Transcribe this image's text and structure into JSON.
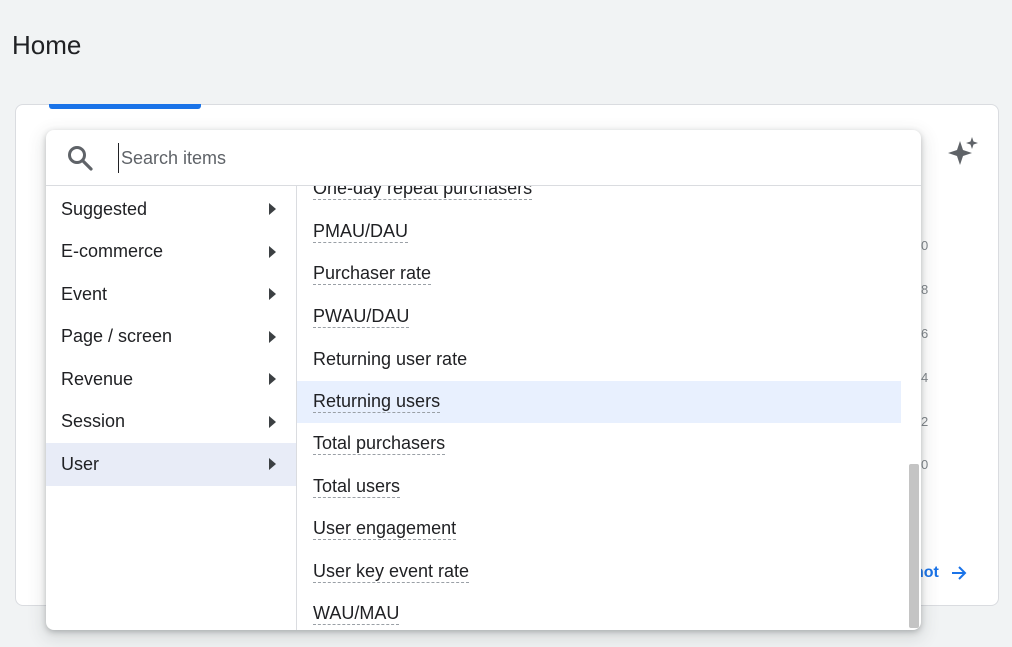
{
  "page": {
    "title": "Home"
  },
  "card": {
    "y_ticks": [
      "0",
      "8",
      "6",
      "4",
      "2",
      "0"
    ],
    "link_label": "not"
  },
  "search": {
    "placeholder": "Search items",
    "value": ""
  },
  "categories": [
    {
      "label": "Suggested",
      "active": false
    },
    {
      "label": "E-commerce",
      "active": false
    },
    {
      "label": "Event",
      "active": false
    },
    {
      "label": "Page / screen",
      "active": false
    },
    {
      "label": "Revenue",
      "active": false
    },
    {
      "label": "Session",
      "active": false
    },
    {
      "label": "User",
      "active": true
    }
  ],
  "metrics": [
    {
      "label": "One-day repeat purchasers",
      "dashed": true,
      "highlight": false
    },
    {
      "label": "PMAU/DAU",
      "dashed": true,
      "highlight": false
    },
    {
      "label": "Purchaser rate",
      "dashed": true,
      "highlight": false
    },
    {
      "label": "PWAU/DAU",
      "dashed": true,
      "highlight": false
    },
    {
      "label": "Returning user rate",
      "dashed": false,
      "highlight": false
    },
    {
      "label": "Returning users",
      "dashed": true,
      "highlight": true
    },
    {
      "label": "Total purchasers",
      "dashed": true,
      "highlight": false
    },
    {
      "label": "Total users",
      "dashed": true,
      "highlight": false
    },
    {
      "label": "User engagement",
      "dashed": true,
      "highlight": false
    },
    {
      "label": "User key event rate",
      "dashed": true,
      "highlight": false
    },
    {
      "label": "WAU/MAU",
      "dashed": true,
      "highlight": false
    }
  ],
  "colors": {
    "accent": "#1a73e8",
    "highlight": "#e8f0fe",
    "active_category": "#e8ecf7"
  }
}
